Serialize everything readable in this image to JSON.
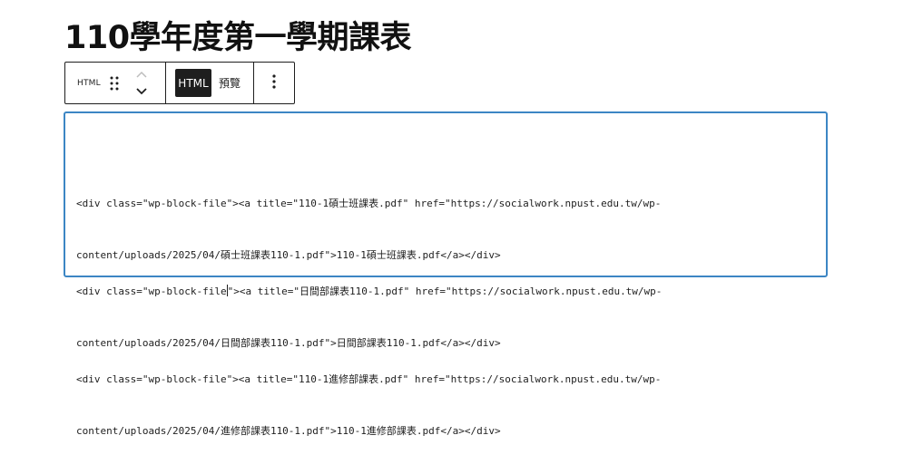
{
  "page": {
    "title": "110學年度第一學期課表"
  },
  "toolbar": {
    "block_type_label": "HTML",
    "html_button": "HTML",
    "preview_button": "預覽"
  },
  "editor": {
    "paragraphs": [
      {
        "line1": "<div class=\"wp-block-file\"><a title=\"110-1碩士班課表.pdf\" href=\"https://socialwork.npust.edu.tw/wp-",
        "line2": "content/uploads/2025/04/碩士班課表110-1.pdf\">110-1碩士班課表.pdf</a></div>"
      },
      {
        "line1a": "<div class=\"wp-block-file",
        "line1b": "\"><a title=\"日間部課表110-1.pdf\" href=\"https://socialwork.npust.edu.tw/wp-",
        "line2": "content/uploads/2025/04/日間部課表110-1.pdf\">日間部課表110-1.pdf</a></div>"
      },
      {
        "line1": "<div class=\"wp-block-file\"><a title=\"110-1進修部課表.pdf\" href=\"https://socialwork.npust.edu.tw/wp-",
        "line2": "content/uploads/2025/04/進修部課表110-1.pdf\">110-1進修部課表.pdf</a></div>"
      }
    ]
  }
}
